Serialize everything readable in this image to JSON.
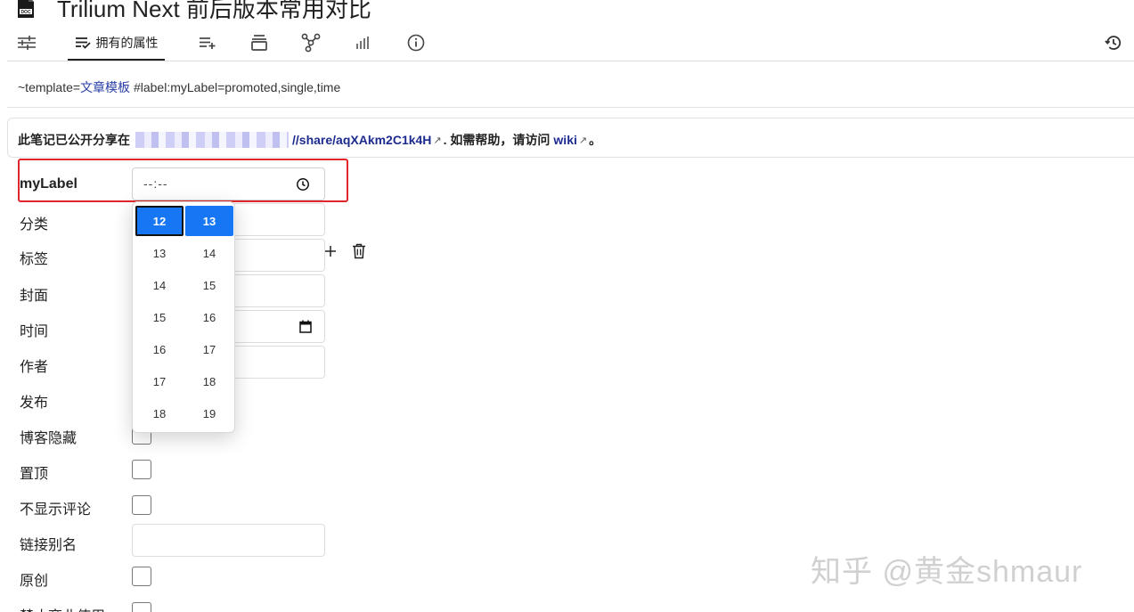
{
  "note": {
    "title": "Trilium Next 前后版本常用对比",
    "icon": "doc-icon"
  },
  "tabs": [
    {
      "name": "basic-properties-tab",
      "icon": "sliders-icon",
      "label": ""
    },
    {
      "name": "owned-attributes-tab",
      "icon": "attribute-list-icon",
      "label": "拥有的属性",
      "active": true
    },
    {
      "name": "inherited-attributes-tab",
      "icon": "playlist-add-icon",
      "label": ""
    },
    {
      "name": "note-paths-tab",
      "icon": "stack-icon",
      "label": ""
    },
    {
      "name": "note-map-tab",
      "icon": "network-icon",
      "label": ""
    },
    {
      "name": "similar-notes-tab",
      "icon": "bar-chart-icon",
      "label": ""
    },
    {
      "name": "note-info-tab",
      "icon": "info-icon",
      "label": ""
    }
  ],
  "history_icon": "history-icon",
  "attributes_line": {
    "prefix": "~template=",
    "template_link": "文章模板",
    "suffix": " #label:myLabel=promoted,single,time"
  },
  "share_notice": {
    "before": "此笔记已公开分享在",
    "url_visible": "//share/aqXAkm2C1k4H",
    "ext_mark": "↗",
    "middle": ". 如需帮助，请访问",
    "wiki_link": "wiki",
    "after": "。"
  },
  "promoted": {
    "mylabel": {
      "label": "myLabel",
      "placeholder": "--:--"
    },
    "category": {
      "label": "分类"
    },
    "tags": {
      "label": "标签"
    },
    "cover": {
      "label": "封面"
    },
    "time": {
      "label": "时间"
    },
    "author": {
      "label": "作者"
    },
    "publish": {
      "label": "发布"
    },
    "hidden": {
      "label": "博客隐藏"
    },
    "pinned": {
      "label": "置顶"
    },
    "no_comments": {
      "label": "不显示评论"
    },
    "alias": {
      "label": "链接别名"
    },
    "original": {
      "label": "原创"
    },
    "no_commercial": {
      "label": "禁止商业使用"
    }
  },
  "time_picker": {
    "hours": [
      "12",
      "13",
      "14",
      "15",
      "16",
      "17",
      "18"
    ],
    "minutes": [
      "13",
      "14",
      "15",
      "16",
      "17",
      "18",
      "19"
    ],
    "selected_hour": "12",
    "selected_minute": "13"
  },
  "watermark": "知乎 @黄金shmaur",
  "colors": {
    "highlight": "#e0262b",
    "accent": "#1676f3",
    "link": "#2a3fa8"
  }
}
